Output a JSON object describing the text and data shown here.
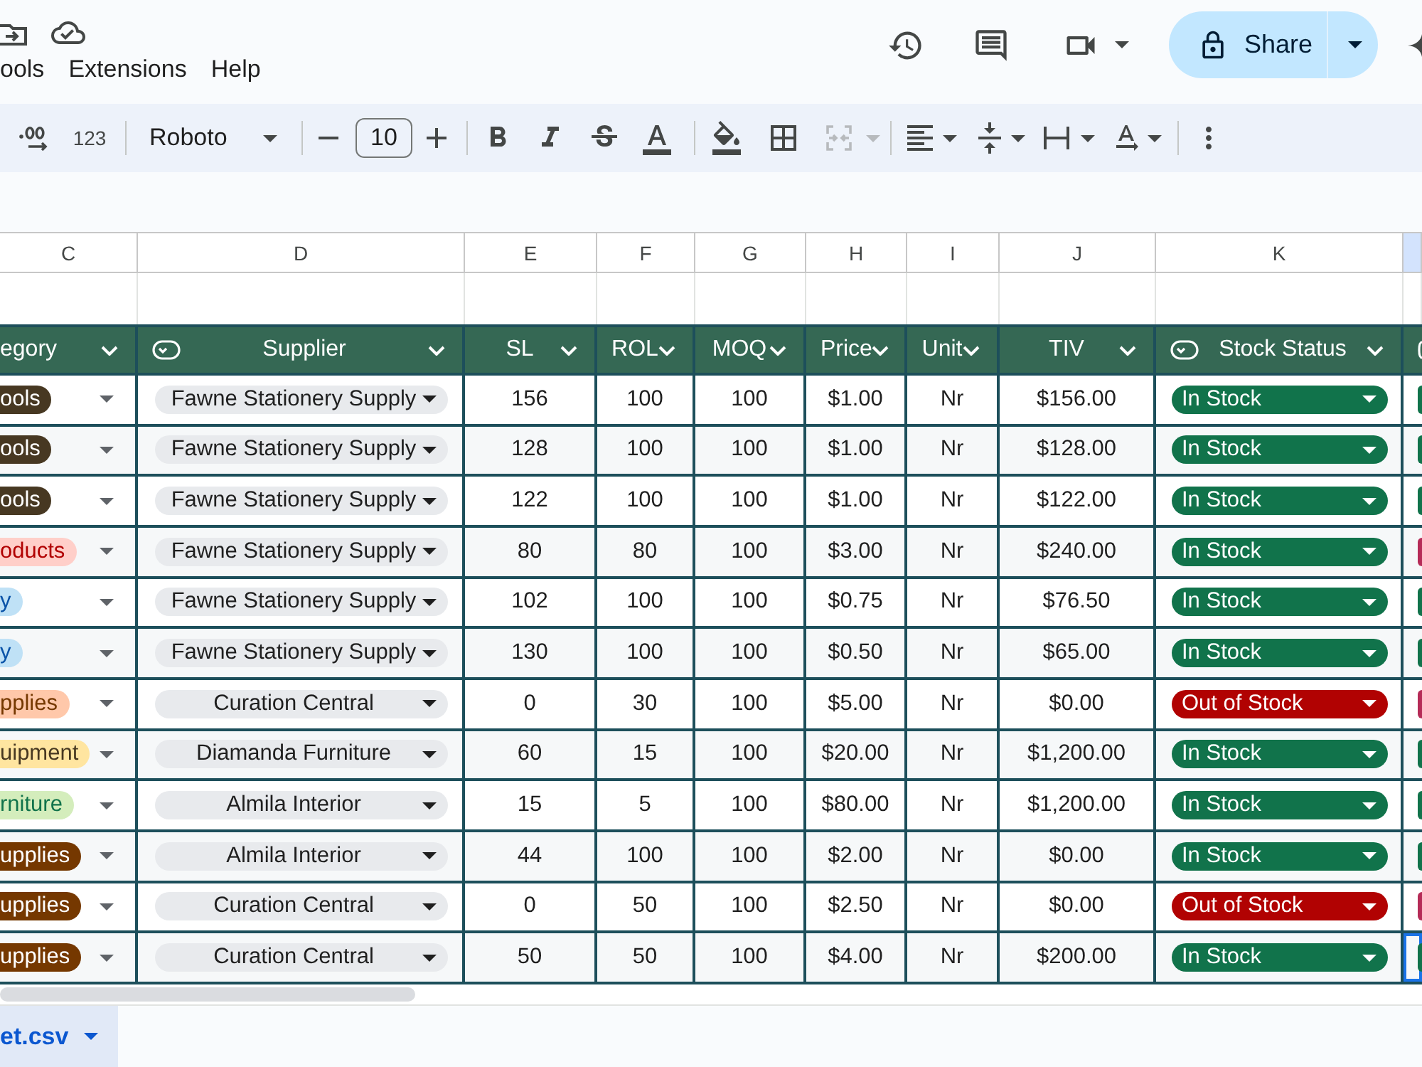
{
  "header": {
    "menu": [
      "ools",
      "Extensions",
      "Help"
    ],
    "share": {
      "label": "Share"
    }
  },
  "toolbar": {
    "number_format_label": "123",
    "font": "Roboto",
    "font_size": "10",
    "merge_disabled": true
  },
  "column_letters": [
    {
      "label": "C",
      "selected": false
    },
    {
      "label": "D",
      "selected": false
    },
    {
      "label": "E",
      "selected": false
    },
    {
      "label": "F",
      "selected": false
    },
    {
      "label": "G",
      "selected": false
    },
    {
      "label": "H",
      "selected": false
    },
    {
      "label": "I",
      "selected": false
    },
    {
      "label": "J",
      "selected": false
    },
    {
      "label": "K",
      "selected": false
    },
    {
      "selected": true
    }
  ],
  "table": {
    "columns": [
      {
        "label": "egory",
        "kind": "plain"
      },
      {
        "label": "Supplier",
        "kind": "dropdown"
      },
      {
        "label": "SL",
        "kind": "plain"
      },
      {
        "label": "ROL",
        "kind": "plain"
      },
      {
        "label": "MOQ",
        "kind": "plain"
      },
      {
        "label": "Price",
        "kind": "plain"
      },
      {
        "label": "Unit",
        "kind": "plain"
      },
      {
        "label": "TIV",
        "kind": "plain"
      },
      {
        "label": "Stock Status",
        "kind": "dropdown"
      },
      {
        "kind": "dropdown"
      }
    ],
    "rows": [
      {
        "category": {
          "text": "ools",
          "color": "#473822"
        },
        "supplier": "Fawne Stationery Supply",
        "sl": "156",
        "rol": "100",
        "moq": "100",
        "price": "$1.00",
        "unit": "Nr",
        "tiv": "$156.00",
        "stock_status": {
          "text": "In Stock",
          "color": "#11734b"
        },
        "edge_cell": {
          "color": "#11734b",
          "selected": false
        }
      },
      {
        "category": {
          "text": "ools",
          "color": "#473822"
        },
        "supplier": "Fawne Stationery Supply",
        "sl": "128",
        "rol": "100",
        "moq": "100",
        "price": "$1.00",
        "unit": "Nr",
        "tiv": "$128.00",
        "stock_status": {
          "text": "In Stock",
          "color": "#11734b"
        },
        "edge_cell": {
          "color": "#11734b",
          "selected": false
        }
      },
      {
        "category": {
          "text": "ools",
          "color": "#473822"
        },
        "supplier": "Fawne Stationery Supply",
        "sl": "122",
        "rol": "100",
        "moq": "100",
        "price": "$1.00",
        "unit": "Nr",
        "tiv": "$122.00",
        "stock_status": {
          "text": "In Stock",
          "color": "#11734b"
        },
        "edge_cell": {
          "color": "#11734b",
          "selected": false
        }
      },
      {
        "category": {
          "text": "oducts",
          "color": "#ffcfc9"
        },
        "supplier": "Fawne Stationery Supply",
        "sl": "80",
        "rol": "80",
        "moq": "100",
        "price": "$3.00",
        "unit": "Nr",
        "tiv": "$240.00",
        "stock_status": {
          "text": "In Stock",
          "color": "#11734b"
        },
        "edge_cell": {
          "color": "#b52b57",
          "selected": false
        }
      },
      {
        "category": {
          "text": "y",
          "color": "#bfe1f6"
        },
        "supplier": "Fawne Stationery Supply",
        "sl": "102",
        "rol": "100",
        "moq": "100",
        "price": "$0.75",
        "unit": "Nr",
        "tiv": "$76.50",
        "stock_status": {
          "text": "In Stock",
          "color": "#11734b"
        },
        "edge_cell": {
          "color": "#11734b",
          "selected": false
        }
      },
      {
        "category": {
          "text": "y",
          "color": "#bfe1f6"
        },
        "supplier": "Fawne Stationery Supply",
        "sl": "130",
        "rol": "100",
        "moq": "100",
        "price": "$0.50",
        "unit": "Nr",
        "tiv": "$65.00",
        "stock_status": {
          "text": "In Stock",
          "color": "#11734b"
        },
        "edge_cell": {
          "color": "#11734b",
          "selected": false
        }
      },
      {
        "category": {
          "text": "pplies",
          "color": "#ffc8aa"
        },
        "supplier": "Curation Central",
        "sl": "0",
        "rol": "30",
        "moq": "100",
        "price": "$5.00",
        "unit": "Nr",
        "tiv": "$0.00",
        "stock_status": {
          "text": "Out of Stock",
          "color": "#b10202"
        },
        "edge_cell": {
          "color": "#b52b57",
          "selected": false
        }
      },
      {
        "category": {
          "text": "uipment",
          "color": "#ffe5a0"
        },
        "supplier": "Diamanda Furniture",
        "sl": "60",
        "rol": "15",
        "moq": "100",
        "price": "$20.00",
        "unit": "Nr",
        "tiv": "$1,200.00",
        "stock_status": {
          "text": "In Stock",
          "color": "#11734b"
        },
        "edge_cell": {
          "color": "#11734b",
          "selected": false
        }
      },
      {
        "category": {
          "text": "rniture",
          "color": "#d4edbc"
        },
        "supplier": "Almila Interior",
        "sl": "15",
        "rol": "5",
        "moq": "100",
        "price": "$80.00",
        "unit": "Nr",
        "tiv": "$1,200.00",
        "stock_status": {
          "text": "In Stock",
          "color": "#11734b"
        },
        "edge_cell": {
          "color": "#11734b",
          "selected": false
        }
      },
      {
        "category": {
          "text": "upplies",
          "color": "#753800"
        },
        "supplier": "Almila Interior",
        "sl": "44",
        "rol": "100",
        "moq": "100",
        "price": "$2.00",
        "unit": "Nr",
        "tiv": "$0.00",
        "stock_status": {
          "text": "In Stock",
          "color": "#11734b"
        },
        "edge_cell": {
          "color": "#11734b",
          "selected": false
        }
      },
      {
        "category": {
          "text": "upplies",
          "color": "#753800"
        },
        "supplier": "Curation Central",
        "sl": "0",
        "rol": "50",
        "moq": "100",
        "price": "$2.50",
        "unit": "Nr",
        "tiv": "$0.00",
        "stock_status": {
          "text": "Out of Stock",
          "color": "#b10202"
        },
        "edge_cell": {
          "color": "#b52b57",
          "selected": false
        }
      },
      {
        "category": {
          "text": "upplies",
          "color": "#753800"
        },
        "supplier": "Curation Central",
        "sl": "50",
        "rol": "50",
        "moq": "100",
        "price": "$4.00",
        "unit": "Nr",
        "tiv": "$200.00",
        "stock_status": {
          "text": "In Stock",
          "color": "#11734b"
        },
        "edge_cell": {
          "color": "#11734b",
          "selected": true
        }
      }
    ]
  },
  "sheet_tabs": [
    {
      "label": "et.csv",
      "selected": true
    }
  ]
}
